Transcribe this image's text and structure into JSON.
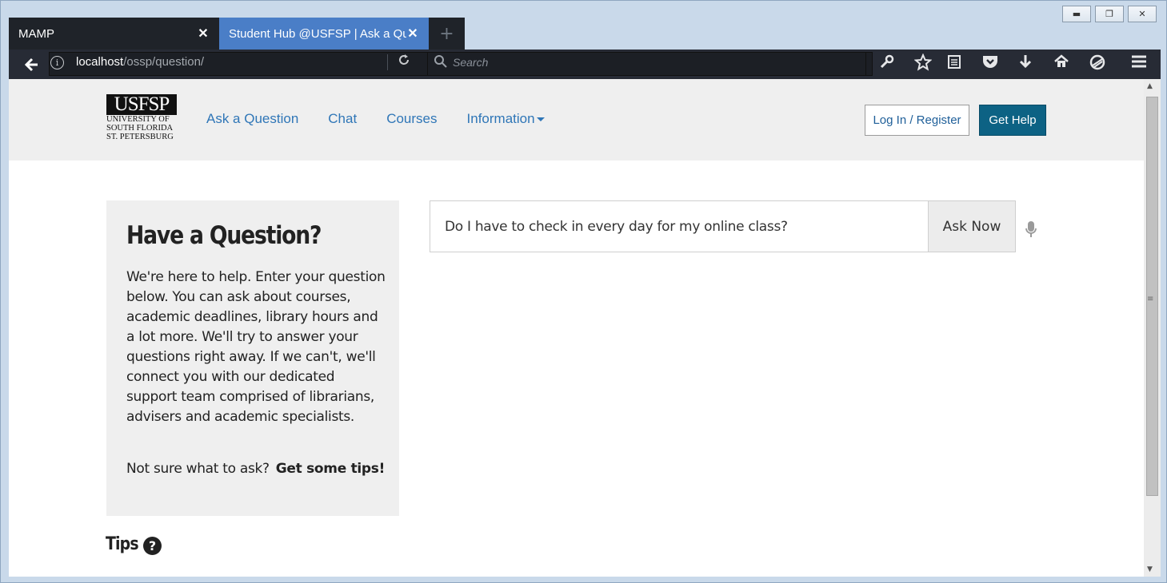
{
  "window": {
    "minimize_glyph": "▬",
    "maximize_glyph": "❐",
    "close_glyph": "✕"
  },
  "tabs": [
    {
      "title": "MAMP",
      "close": "✕"
    },
    {
      "title": "Student Hub @USFSP | Ask a Question",
      "close": "✕"
    }
  ],
  "new_tab_glyph": "+",
  "toolbar": {
    "url_host": "localhost",
    "url_path": "/ossp/question/",
    "search_placeholder": "Search",
    "icons": [
      "wrench-icon",
      "star-icon",
      "reader-icon",
      "pocket-icon",
      "download-icon",
      "home-icon",
      "sync-icon",
      "menu-icon"
    ]
  },
  "site": {
    "logo": {
      "wordmark": "USFSP",
      "lines": [
        "UNIVERSITY OF",
        "SOUTH FLORIDA",
        "ST. PETERSBURG"
      ]
    },
    "nav": [
      {
        "label": "Ask a Question"
      },
      {
        "label": "Chat"
      },
      {
        "label": "Courses"
      },
      {
        "label": "Information"
      }
    ],
    "login_label": "Log In / Register",
    "help_label": "Get Help"
  },
  "question_panel": {
    "title": "Have a Question?",
    "intro": "We're here to help. Enter your question below. You can ask about courses, academic deadlines, library hours and a lot more. We'll try to answer your questions right away. If we can't, we'll connect you with our dedicated support team comprised of librarians, advisers and academic specialists.",
    "tips_prompt": "Not sure what to ask?",
    "tips_link": "Get some tips!"
  },
  "ask": {
    "value": "Do I have to check in every day for my online class?",
    "button_label": "Ask Now"
  },
  "tips": {
    "heading": "Tips",
    "help_glyph": "?"
  },
  "colors": {
    "link": "#2f76b7",
    "primary_button": "#0d6284",
    "active_tab": "#4a7ec7",
    "toolbar": "#272b35"
  }
}
